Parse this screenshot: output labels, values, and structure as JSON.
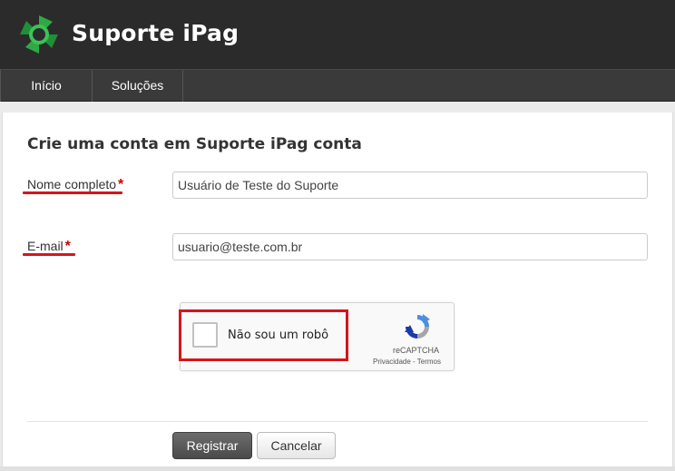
{
  "header": {
    "title": "Suporte iPag",
    "logo_icon": "ipag-logo-icon",
    "brand_color": "#1e9e3a"
  },
  "nav": {
    "items": [
      {
        "label": "Início"
      },
      {
        "label": "Soluções"
      }
    ]
  },
  "form": {
    "title": "Crie uma conta em Suporte iPag conta",
    "required_marker": "*",
    "fields": [
      {
        "label": "Nome completo",
        "value": "Usuário de Teste do Suporte"
      },
      {
        "label": "E-mail",
        "value": "usuario@teste.com.br"
      }
    ],
    "captcha": {
      "label": "Não sou um robô",
      "brand": "reCAPTCHA",
      "links": "Privacidade - Termos"
    },
    "buttons": {
      "submit": "Registrar",
      "cancel": "Cancelar"
    }
  },
  "colors": {
    "highlight": "#d7141b",
    "required": "#cc0000"
  }
}
